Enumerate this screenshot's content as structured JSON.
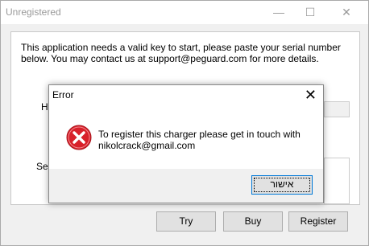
{
  "window": {
    "title": "Unregistered",
    "controls": {
      "minimize": "—",
      "maximize": "☐",
      "close": "✕"
    }
  },
  "main": {
    "message": "This application needs a valid key to start, please paste your serial number below. You may contact us at support@peguard.com for more details.",
    "hardware_label_partial": "Ha",
    "serial_label_partial": "Ser",
    "buttons": {
      "try": "Try",
      "buy": "Buy",
      "register": "Register"
    }
  },
  "dialog": {
    "title": "Error",
    "close_icon": "close-icon",
    "icon": "error-icon",
    "message": "To register this charger please get in touch with nikolcrack@gmail.com",
    "ok_label": "אישור"
  },
  "colors": {
    "error_red": "#d8202a",
    "focus_blue": "#0078d7"
  }
}
